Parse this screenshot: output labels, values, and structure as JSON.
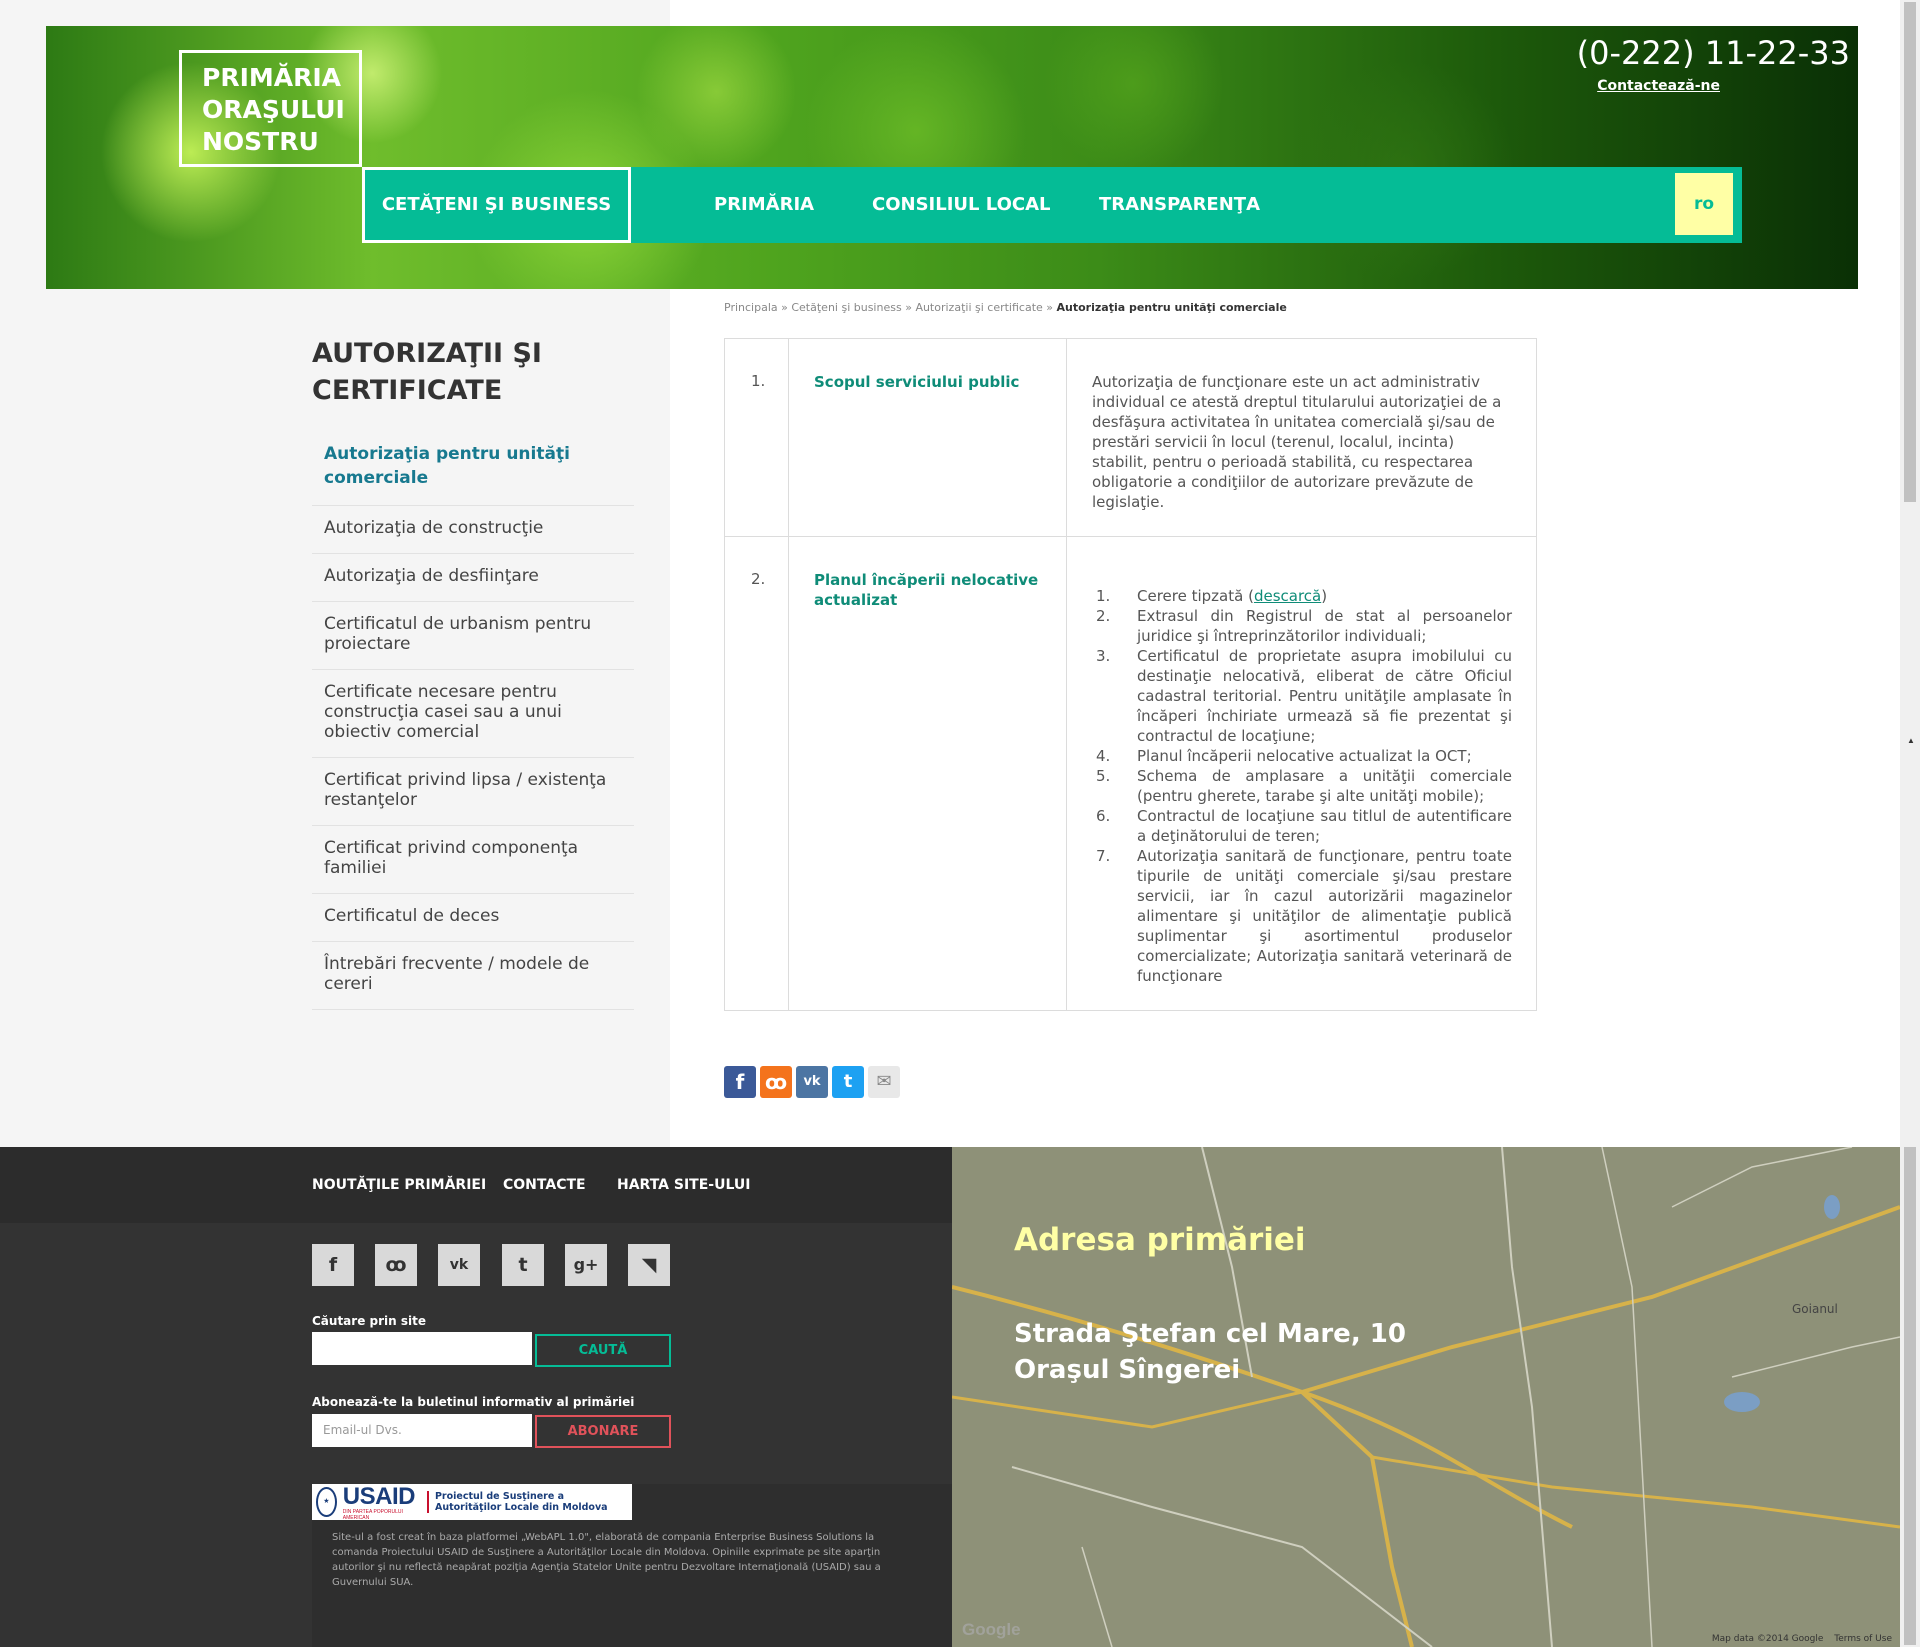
{
  "header": {
    "logo_lines": [
      "PRIMĂRIA",
      "ORAŞULUI",
      "NOSTRU"
    ],
    "phone": "(0-222) 11-22-33",
    "contact_link": "Contactează-ne",
    "nav": [
      "CETĂŢENI ŞI BUSINESS",
      "PRIMĂRIA",
      "CONSILIUL LOCAL",
      "TRANSPARENŢA"
    ],
    "lang": "ro"
  },
  "breadcrumb": {
    "items": [
      "Principala",
      "Cetăţeni şi business",
      "Autorizaţii şi certificate"
    ],
    "separator": "»",
    "current": "Autorizaţia pentru unităţi comerciale"
  },
  "sidebar": {
    "title": "AUTORIZAŢII ŞI CERTIFICATE",
    "items": [
      "Autorizaţia pentru unităţi comerciale",
      "Autorizaţia de construcţie",
      "Autorizaţia de desfiinţare",
      "Certificatul de urbanism pentru proiectare",
      "Certificate necesare pentru construcţia casei sau a unui obiectiv comercial",
      "Certificat privind lipsa / existenţa restanţelor",
      "Certificat privind componenţa familiei",
      "Certificatul de deces",
      "Întrebări frecvente / modele de cereri"
    ]
  },
  "table": {
    "row1": {
      "num": "1.",
      "label": "Scopul serviciului public",
      "text": "Autorizaţia de funcţionare este un act administrativ individual ce atestă dreptul titularului autorizaţiei de a desfăşura activitatea în unitatea comercială şi/sau de prestări servicii în locul (terenul, localul, incinta) stabilit, pentru o perioadă stabilită, cu respectarea obligatorie a condiţiilor de autorizare prevăzute de legislaţie."
    },
    "row2": {
      "num": "2.",
      "label": "Planul încăperii nelocative actualizat",
      "item1_prefix": "Cerere tipzată (",
      "item1_link": "descarcă",
      "item1_suffix": ")",
      "items": [
        {
          "n": "2.",
          "t": "Extrasul din Registrul de stat al persoanelor juridice şi întreprinzătorilor individuali;"
        },
        {
          "n": "3.",
          "t": "Certificatul de proprietate asupra imobilului cu destinaţie nelocativă, eliberat de către Oficiul cadastral teritorial. Pentru unităţile amplasate în încăperi închiriate urmează să fie prezentat şi contractul de locaţiune;"
        },
        {
          "n": "4.",
          "t": "Planul încăperii nelocative actualizat la OCT;"
        },
        {
          "n": "5.",
          "t": "Schema de amplasare a unităţii comerciale (pentru gherete, tarabe şi alte unităţi mobile);"
        },
        {
          "n": "6.",
          "t": "Contractul de locaţiune sau titlul de autentificare a deţinătorului de teren;"
        },
        {
          "n": "7.",
          "t": "Autorizaţia sanitară de funcţionare, pentru toate tipurile de unităţi comerciale şi/sau prestare servicii, iar în cazul autorizării magazinelor alimentare şi unităţilor de alimentaţie publică suplimentar şi asortimentul produselor comercializate; Autorizaţia sanitară veterinară de funcţionare"
        }
      ]
    }
  },
  "share_icons": [
    "facebook-icon",
    "odnoklassniki-icon",
    "vk-icon",
    "twitter-icon",
    "mail-icon"
  ],
  "footer": {
    "nav": [
      "NOUTĂŢILE PRIMĂRIEI",
      "CONTACTE",
      "HARTA SITE-ULUI"
    ],
    "social_icons": [
      "facebook-icon",
      "odnoklassniki-icon",
      "vk-icon",
      "twitter-icon",
      "google-plus-icon",
      "rss-icon"
    ],
    "search_label": "Căutare prin site",
    "search_button": "CAUTĂ",
    "newsletter_label": "Abonează-te la buletinul informativ al primăriei",
    "email_placeholder": "Email-ul Dvs.",
    "subscribe_button": "ABONARE",
    "usaid_name": "USAID",
    "usaid_seal_sub": "DIN PARTEA POPORULUI AMERICAN",
    "usaid_project": "Proiectul de Susţinere a Autorităţilor Locale din Moldova",
    "disclaimer": "Site-ul a fost creat în baza platformei „WebAPL 1.0\", elaborată de compania Enterprise Business Solutions la comanda Proiectului USAID de Susţinere a Autorităţilor Locale din Moldova. Opiniile exprimate pe site aparţin autorilor şi nu reflectă neapărat poziţia Agenţia Statelor Unite pentru Dezvoltare Internaţională (USAID) sau a Guvernului SUA."
  },
  "map": {
    "title": "Adresa primăriei",
    "address_line1": "Strada Ştefan cel Mare, 10",
    "address_line2": "Oraşul Sîngerei",
    "credit": "Map data ©2014 Google",
    "terms": "Terms of Use",
    "google": "Google",
    "town_label": "Goianul"
  },
  "colors": {
    "accent": "#05bc96",
    "lang_bg": "#ffffa5",
    "label_green": "#0f8c78",
    "side_active": "#17798f",
    "footer_bg": "#333333",
    "subscribe_red": "#e0525a"
  }
}
